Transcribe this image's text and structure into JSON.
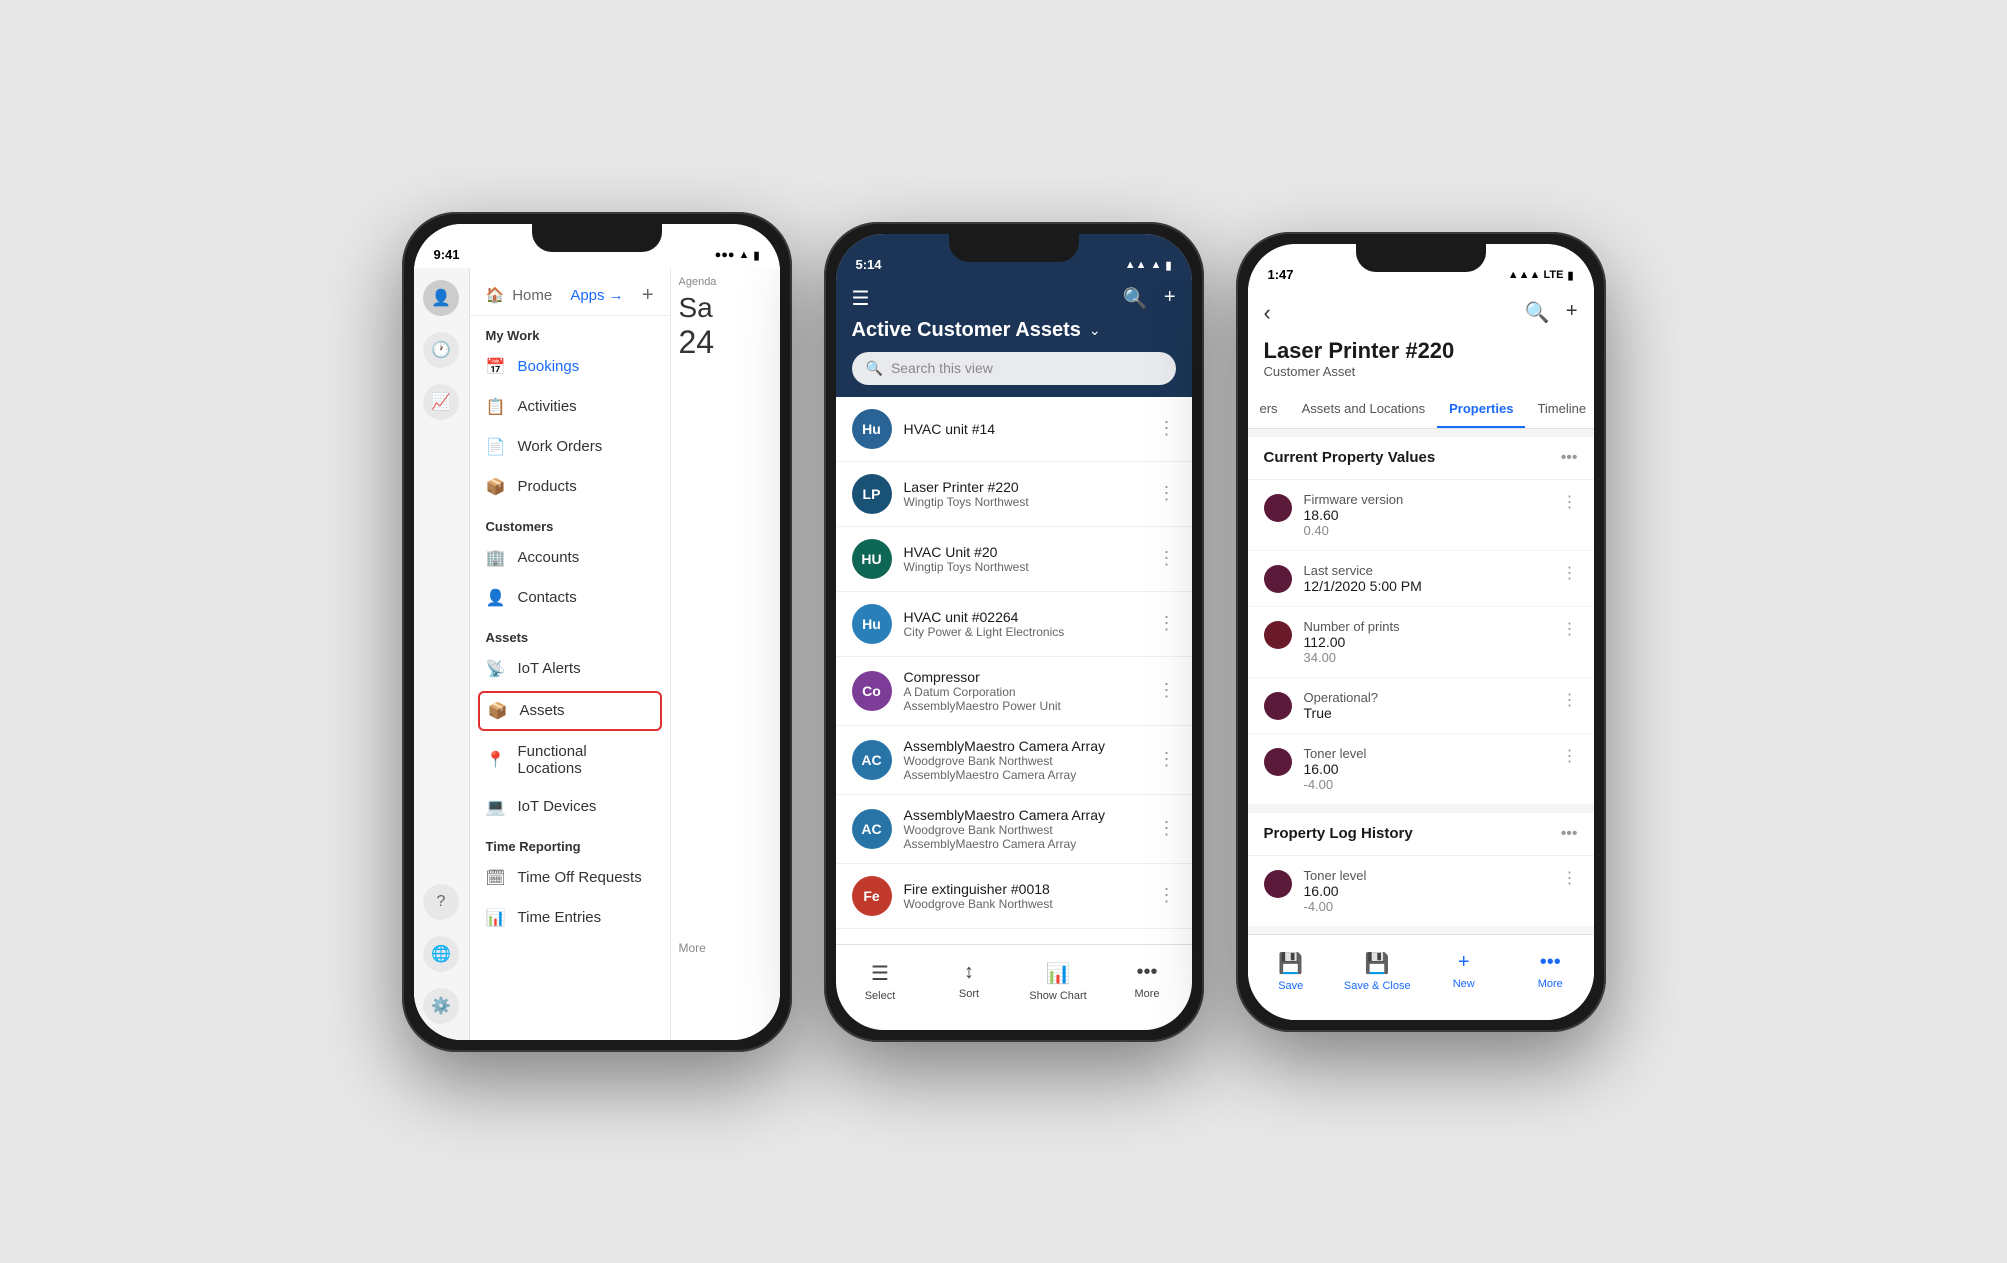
{
  "phone1": {
    "status_time": "9:41",
    "header": {
      "home_label": "Home",
      "apps_label": "Apps →",
      "plus": "+"
    },
    "my_work_label": "My Work",
    "nav_items": [
      {
        "icon": "📅",
        "label": "Bookings",
        "active": true
      },
      {
        "icon": "📋",
        "label": "Activities",
        "active": false
      },
      {
        "icon": "📄",
        "label": "Work Orders",
        "active": false
      },
      {
        "icon": "📦",
        "label": "Products",
        "active": false
      }
    ],
    "customers_label": "Customers",
    "customer_items": [
      {
        "icon": "🏢",
        "label": "Accounts",
        "active": false
      },
      {
        "icon": "👤",
        "label": "Contacts",
        "active": false
      }
    ],
    "assets_label": "Assets",
    "asset_items": [
      {
        "icon": "📡",
        "label": "IoT Alerts",
        "active": false
      },
      {
        "icon": "📦",
        "label": "Assets",
        "active": false,
        "highlighted": true
      },
      {
        "icon": "📍",
        "label": "Functional Locations",
        "active": false
      },
      {
        "icon": "💻",
        "label": "IoT Devices",
        "active": false
      }
    ],
    "time_label": "Time Reporting",
    "time_items": [
      {
        "icon": "🗓",
        "label": "Time Off Requests",
        "active": false
      },
      {
        "icon": "📊",
        "label": "Time Entries",
        "active": false
      }
    ],
    "calendar_day": "Sa",
    "calendar_date": "24",
    "agenda_label": "Agenda",
    "more_label": "More"
  },
  "phone2": {
    "status_time": "5:14",
    "list_title": "Active Customer Assets",
    "search_placeholder": "Search this view",
    "assets": [
      {
        "initials": "Hu",
        "color": "#2a6496",
        "name": "HVAC unit #14",
        "sub1": "",
        "sub2": ""
      },
      {
        "initials": "LP",
        "color": "#1a5276",
        "name": "Laser Printer #220",
        "sub1": "Wingtip Toys Northwest",
        "sub2": ""
      },
      {
        "initials": "HU",
        "color": "#0e6655",
        "name": "HVAC Unit #20",
        "sub1": "Wingtip Toys Northwest",
        "sub2": ""
      },
      {
        "initials": "Hu",
        "color": "#2980b9",
        "name": "HVAC unit #02264",
        "sub1": "City Power & Light Electronics",
        "sub2": ""
      },
      {
        "initials": "Co",
        "color": "#7d3c98",
        "name": "Compressor",
        "sub1": "A Datum Corporation",
        "sub2": "AssemblyMaestro Power Unit"
      },
      {
        "initials": "AC",
        "color": "#2874a6",
        "name": "AssemblyMaestro Camera Array",
        "sub1": "Woodgrove Bank Northwest",
        "sub2": "AssemblyMaestro Camera Array"
      },
      {
        "initials": "AC",
        "color": "#2874a6",
        "name": "AssemblyMaestro Camera Array",
        "sub1": "Woodgrove Bank Northwest",
        "sub2": "AssemblyMaestro Camera Array"
      },
      {
        "initials": "Fe",
        "color": "#c0392b",
        "name": "Fire extinguisher #0018",
        "sub1": "Woodgrove Bank Northwest",
        "sub2": ""
      }
    ],
    "toolbar": {
      "select_label": "Select",
      "sort_label": "Sort",
      "chart_label": "Show Chart",
      "more_label": "More"
    }
  },
  "phone3": {
    "status_time": "1:47",
    "title": "Laser Printer #220",
    "subtitle": "Customer Asset",
    "tabs": [
      {
        "label": "ers",
        "active": false
      },
      {
        "label": "Assets and Locations",
        "active": false
      },
      {
        "label": "Properties",
        "active": true
      },
      {
        "label": "Timeline",
        "active": false
      }
    ],
    "sections": [
      {
        "title": "Current Property Values",
        "items": [
          {
            "label": "Firmware version",
            "value": "18.60",
            "value2": "0.40"
          },
          {
            "label": "Last service",
            "value": "12/1/2020 5:00 PM",
            "value2": ""
          },
          {
            "label": "Number of prints",
            "value": "112.00",
            "value2": "34.00"
          },
          {
            "label": "Operational?",
            "value": "True",
            "value2": ""
          },
          {
            "label": "Toner level",
            "value": "16.00",
            "value2": "-4.00"
          }
        ]
      },
      {
        "title": "Property Log History",
        "items": [
          {
            "label": "Toner level",
            "value": "16.00",
            "value2": "-4.00"
          }
        ]
      }
    ],
    "toolbar": {
      "save_label": "Save",
      "save_close_label": "Save & Close",
      "new_label": "New",
      "more_label": "More"
    }
  }
}
